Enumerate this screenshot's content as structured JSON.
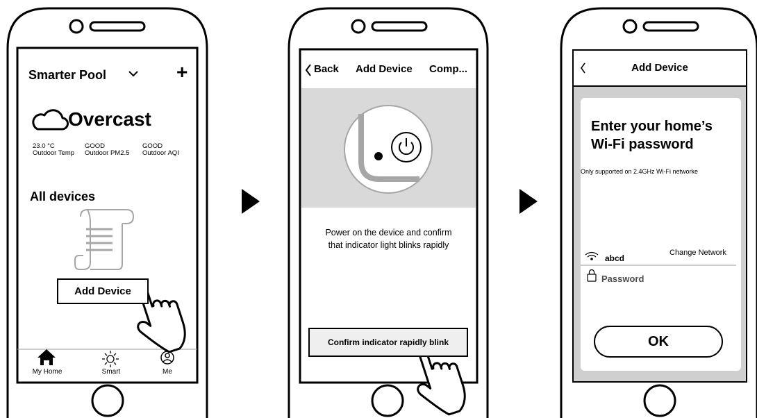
{
  "screen1": {
    "app_title": "Smarter Pool",
    "add_symbol": "+",
    "weather_label": "Overcast",
    "stats": [
      {
        "value": "23.0 °C",
        "label": "Outdoor Temp"
      },
      {
        "value": "GOOD",
        "label": "Outdoor PM2.5"
      },
      {
        "value": "GOOD",
        "label": "Outdoor AQI"
      }
    ],
    "section_title": "All devices",
    "add_device_button": "Add Device",
    "nav": [
      {
        "label": "My Home",
        "icon": "home-icon"
      },
      {
        "label": "Smart",
        "icon": "sun-icon"
      },
      {
        "label": "Me",
        "icon": "user-icon"
      }
    ]
  },
  "screen2": {
    "back_label": "Back",
    "title": "Add Device",
    "right_action": "Comp...",
    "instruction_line1": "Power on the device and confirm",
    "instruction_line2": "that indicator light blinks rapidly",
    "confirm_button": "Confirm indicator rapidly blink"
  },
  "screen3": {
    "title": "Add Device",
    "heading_line1": "Enter your home’s",
    "heading_line2": "Wi-Fi password",
    "note": "Only supported on 2.4GHz Wi-Fi networke",
    "network_name": "abcd",
    "change_network": "Change Network",
    "password_placeholder": "Password",
    "ok_button": "OK"
  },
  "colors": {
    "stroke": "#000000",
    "panel_gray": "#cfcfcf",
    "illustration_gray": "#bdbdbd"
  }
}
